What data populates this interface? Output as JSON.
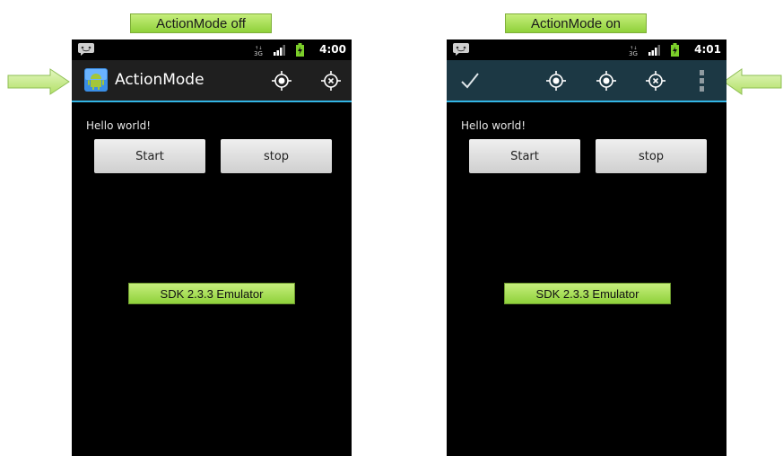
{
  "captions": {
    "left": "ActionMode off",
    "right": "ActionMode on"
  },
  "accent_color": "#33b5e5",
  "caption_color": "#a5dd55",
  "phones": [
    {
      "status_time": "4:00",
      "actionbar": {
        "title": "ActionMode",
        "icons": [
          "android-app-icon",
          "locate-icon",
          "locate-cancel-icon"
        ]
      },
      "hello_text": "Hello world!",
      "start_label": "Start",
      "stop_label": "stop",
      "emulator_label": "SDK 2.3.3 Emulator"
    },
    {
      "status_time": "4:01",
      "actionbar": {
        "icons": [
          "done-check-icon",
          "locate-icon",
          "locate-icon",
          "locate-cancel-icon",
          "overflow-menu-icon"
        ]
      },
      "hello_text": "Hello world!",
      "start_label": "Start",
      "stop_label": "stop",
      "emulator_label": "SDK 2.3.3 Emulator"
    }
  ]
}
